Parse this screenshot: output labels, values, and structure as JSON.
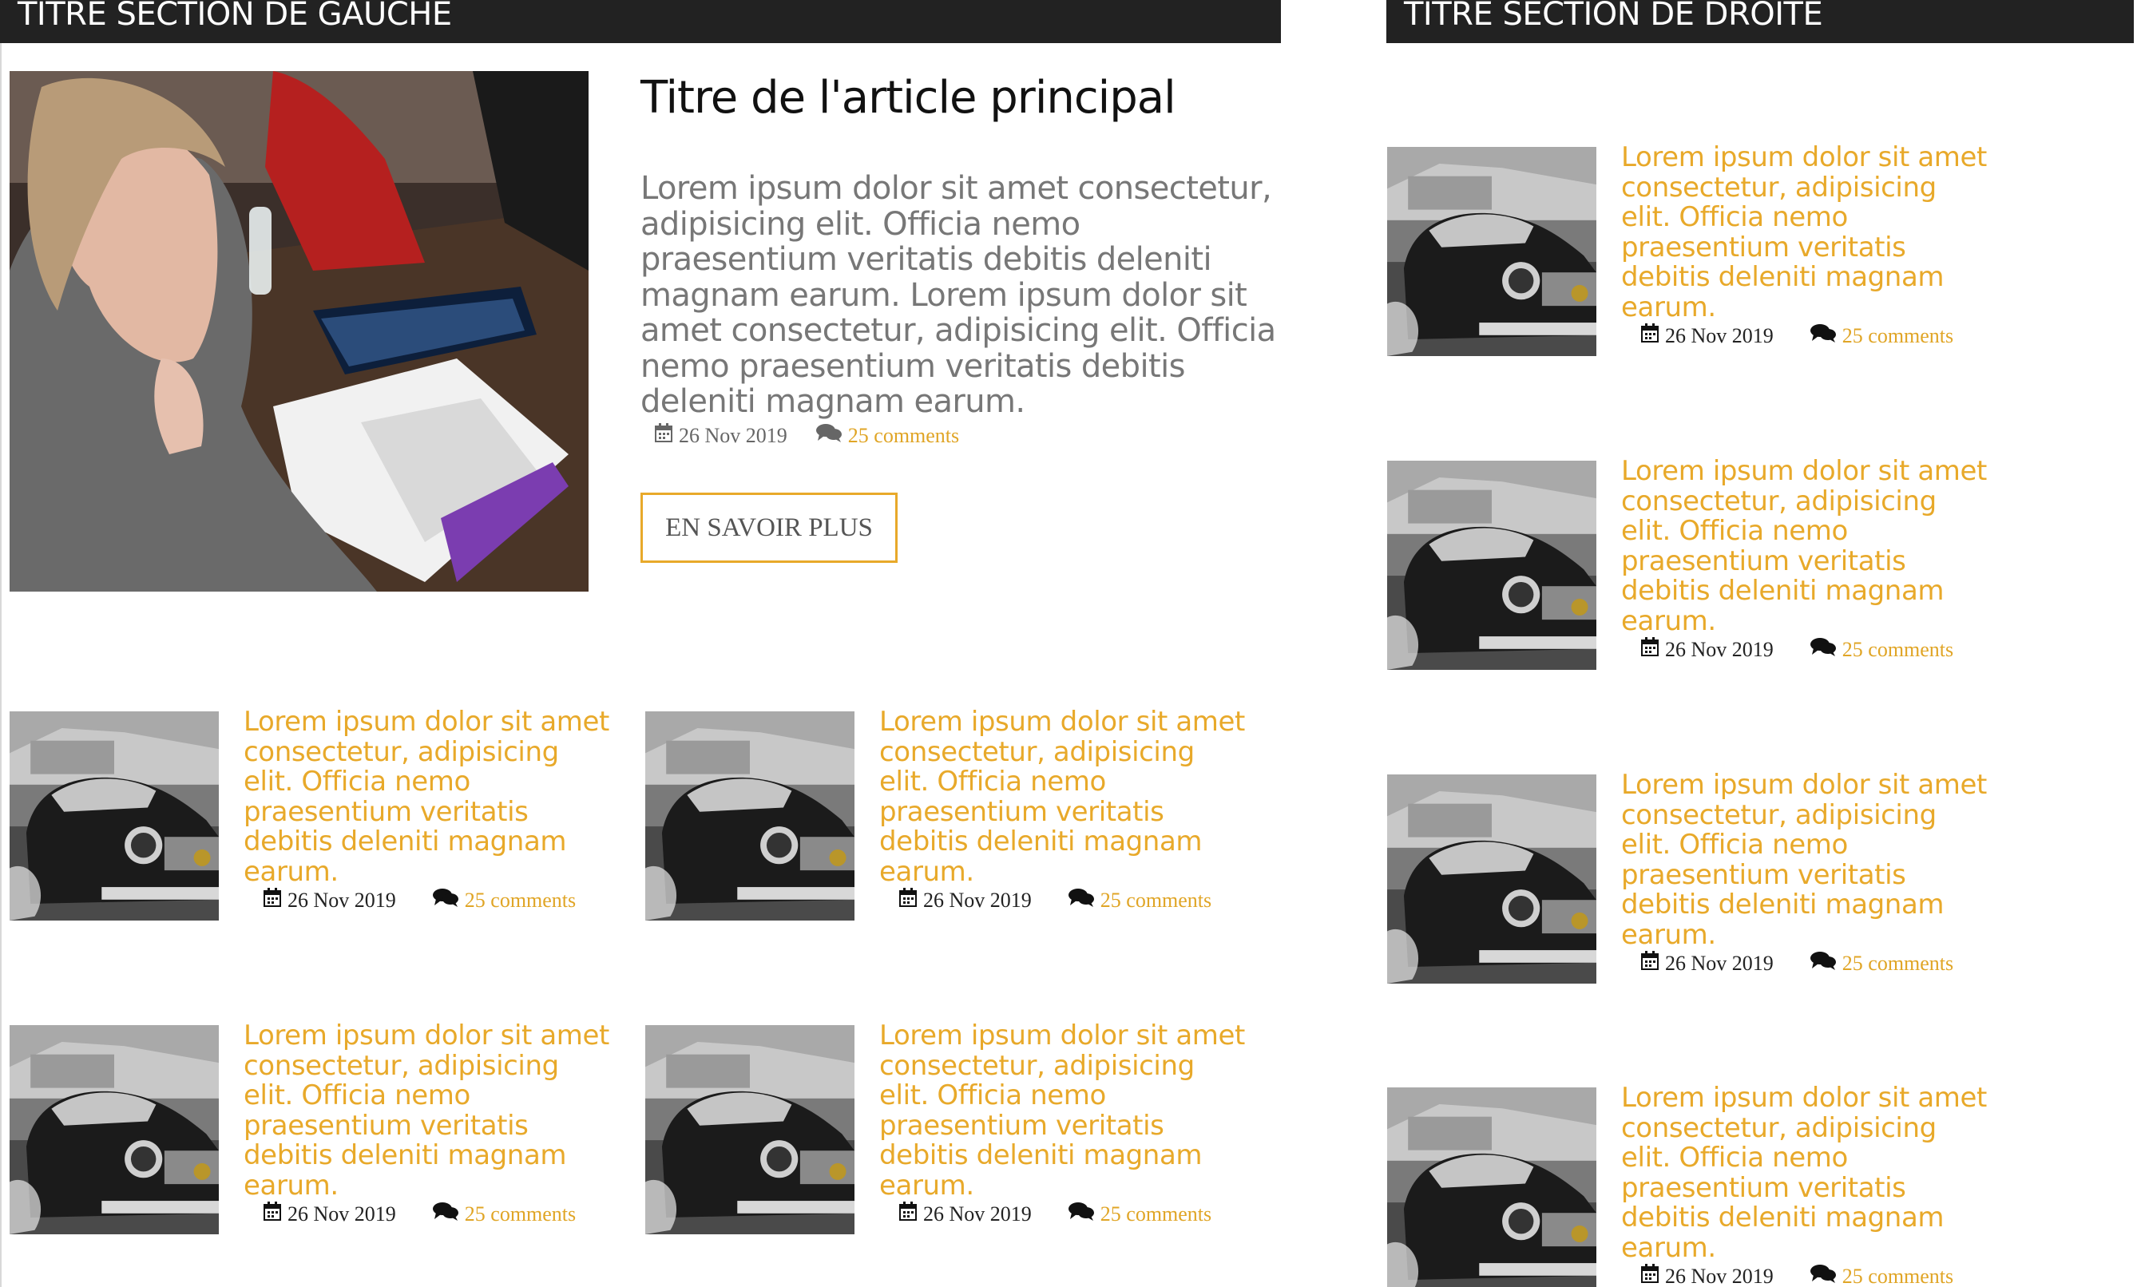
{
  "sections": {
    "left_title": "TITRE SECTION DE GAUCHE",
    "right_title": "TITRE SECTION DE DROITE"
  },
  "main_article": {
    "title": "Titre de l'article principal",
    "excerpt": "Lorem ipsum dolor sit amet consectetur, adipisicing elit. Officia nemo praesentium veritatis debitis deleniti magnam earum. Lorem ipsum dolor sit amet consectetur, adipisicing elit. Officia nemo praesentium veritatis debitis deleniti magnam earum.",
    "date": "26 Nov 2019",
    "comments": "25 comments",
    "button_label": "EN SAVOIR PLUS"
  },
  "left_cards": [
    {
      "text": "Lorem ipsum dolor sit amet consectetur, adipisicing elit. Officia nemo praesentium veritatis debitis deleniti magnam earum.",
      "date": "26 Nov 2019",
      "comments": "25 comments"
    },
    {
      "text": "Lorem ipsum dolor sit amet consectetur, adipisicing elit. Officia nemo praesentium veritatis debitis deleniti magnam earum.",
      "date": "26 Nov 2019",
      "comments": "25 comments"
    },
    {
      "text": "Lorem ipsum dolor sit amet consectetur, adipisicing elit. Officia nemo praesentium veritatis debitis deleniti magnam earum.",
      "date": "26 Nov 2019",
      "comments": "25 comments"
    },
    {
      "text": "Lorem ipsum dolor sit amet consectetur, adipisicing elit. Officia nemo praesentium veritatis debitis deleniti magnam earum.",
      "date": "26 Nov 2019",
      "comments": "25 comments"
    }
  ],
  "right_cards": [
    {
      "text": "Lorem ipsum dolor sit amet consectetur, adipisicing elit. Officia nemo praesentium veritatis debitis deleniti magnam earum.",
      "date": "26 Nov 2019",
      "comments": "25 comments"
    },
    {
      "text": "Lorem ipsum dolor sit amet consectetur, adipisicing elit. Officia nemo praesentium veritatis debitis deleniti magnam earum.",
      "date": "26 Nov 2019",
      "comments": "25 comments"
    },
    {
      "text": "Lorem ipsum dolor sit amet consectetur, adipisicing elit. Officia nemo praesentium veritatis debitis deleniti magnam earum.",
      "date": "26 Nov 2019",
      "comments": "25 comments"
    },
    {
      "text": "Lorem ipsum dolor sit amet consectetur, adipisicing elit. Officia nemo praesentium veritatis debitis deleniti magnam earum.",
      "date": "26 Nov 2019",
      "comments": "25 comments"
    }
  ],
  "icons": {
    "date": "calendar-icon",
    "comments": "comments-icon"
  },
  "colors": {
    "accent": "#e8a92a",
    "header_bg": "#222222",
    "body_text": "#777777"
  }
}
